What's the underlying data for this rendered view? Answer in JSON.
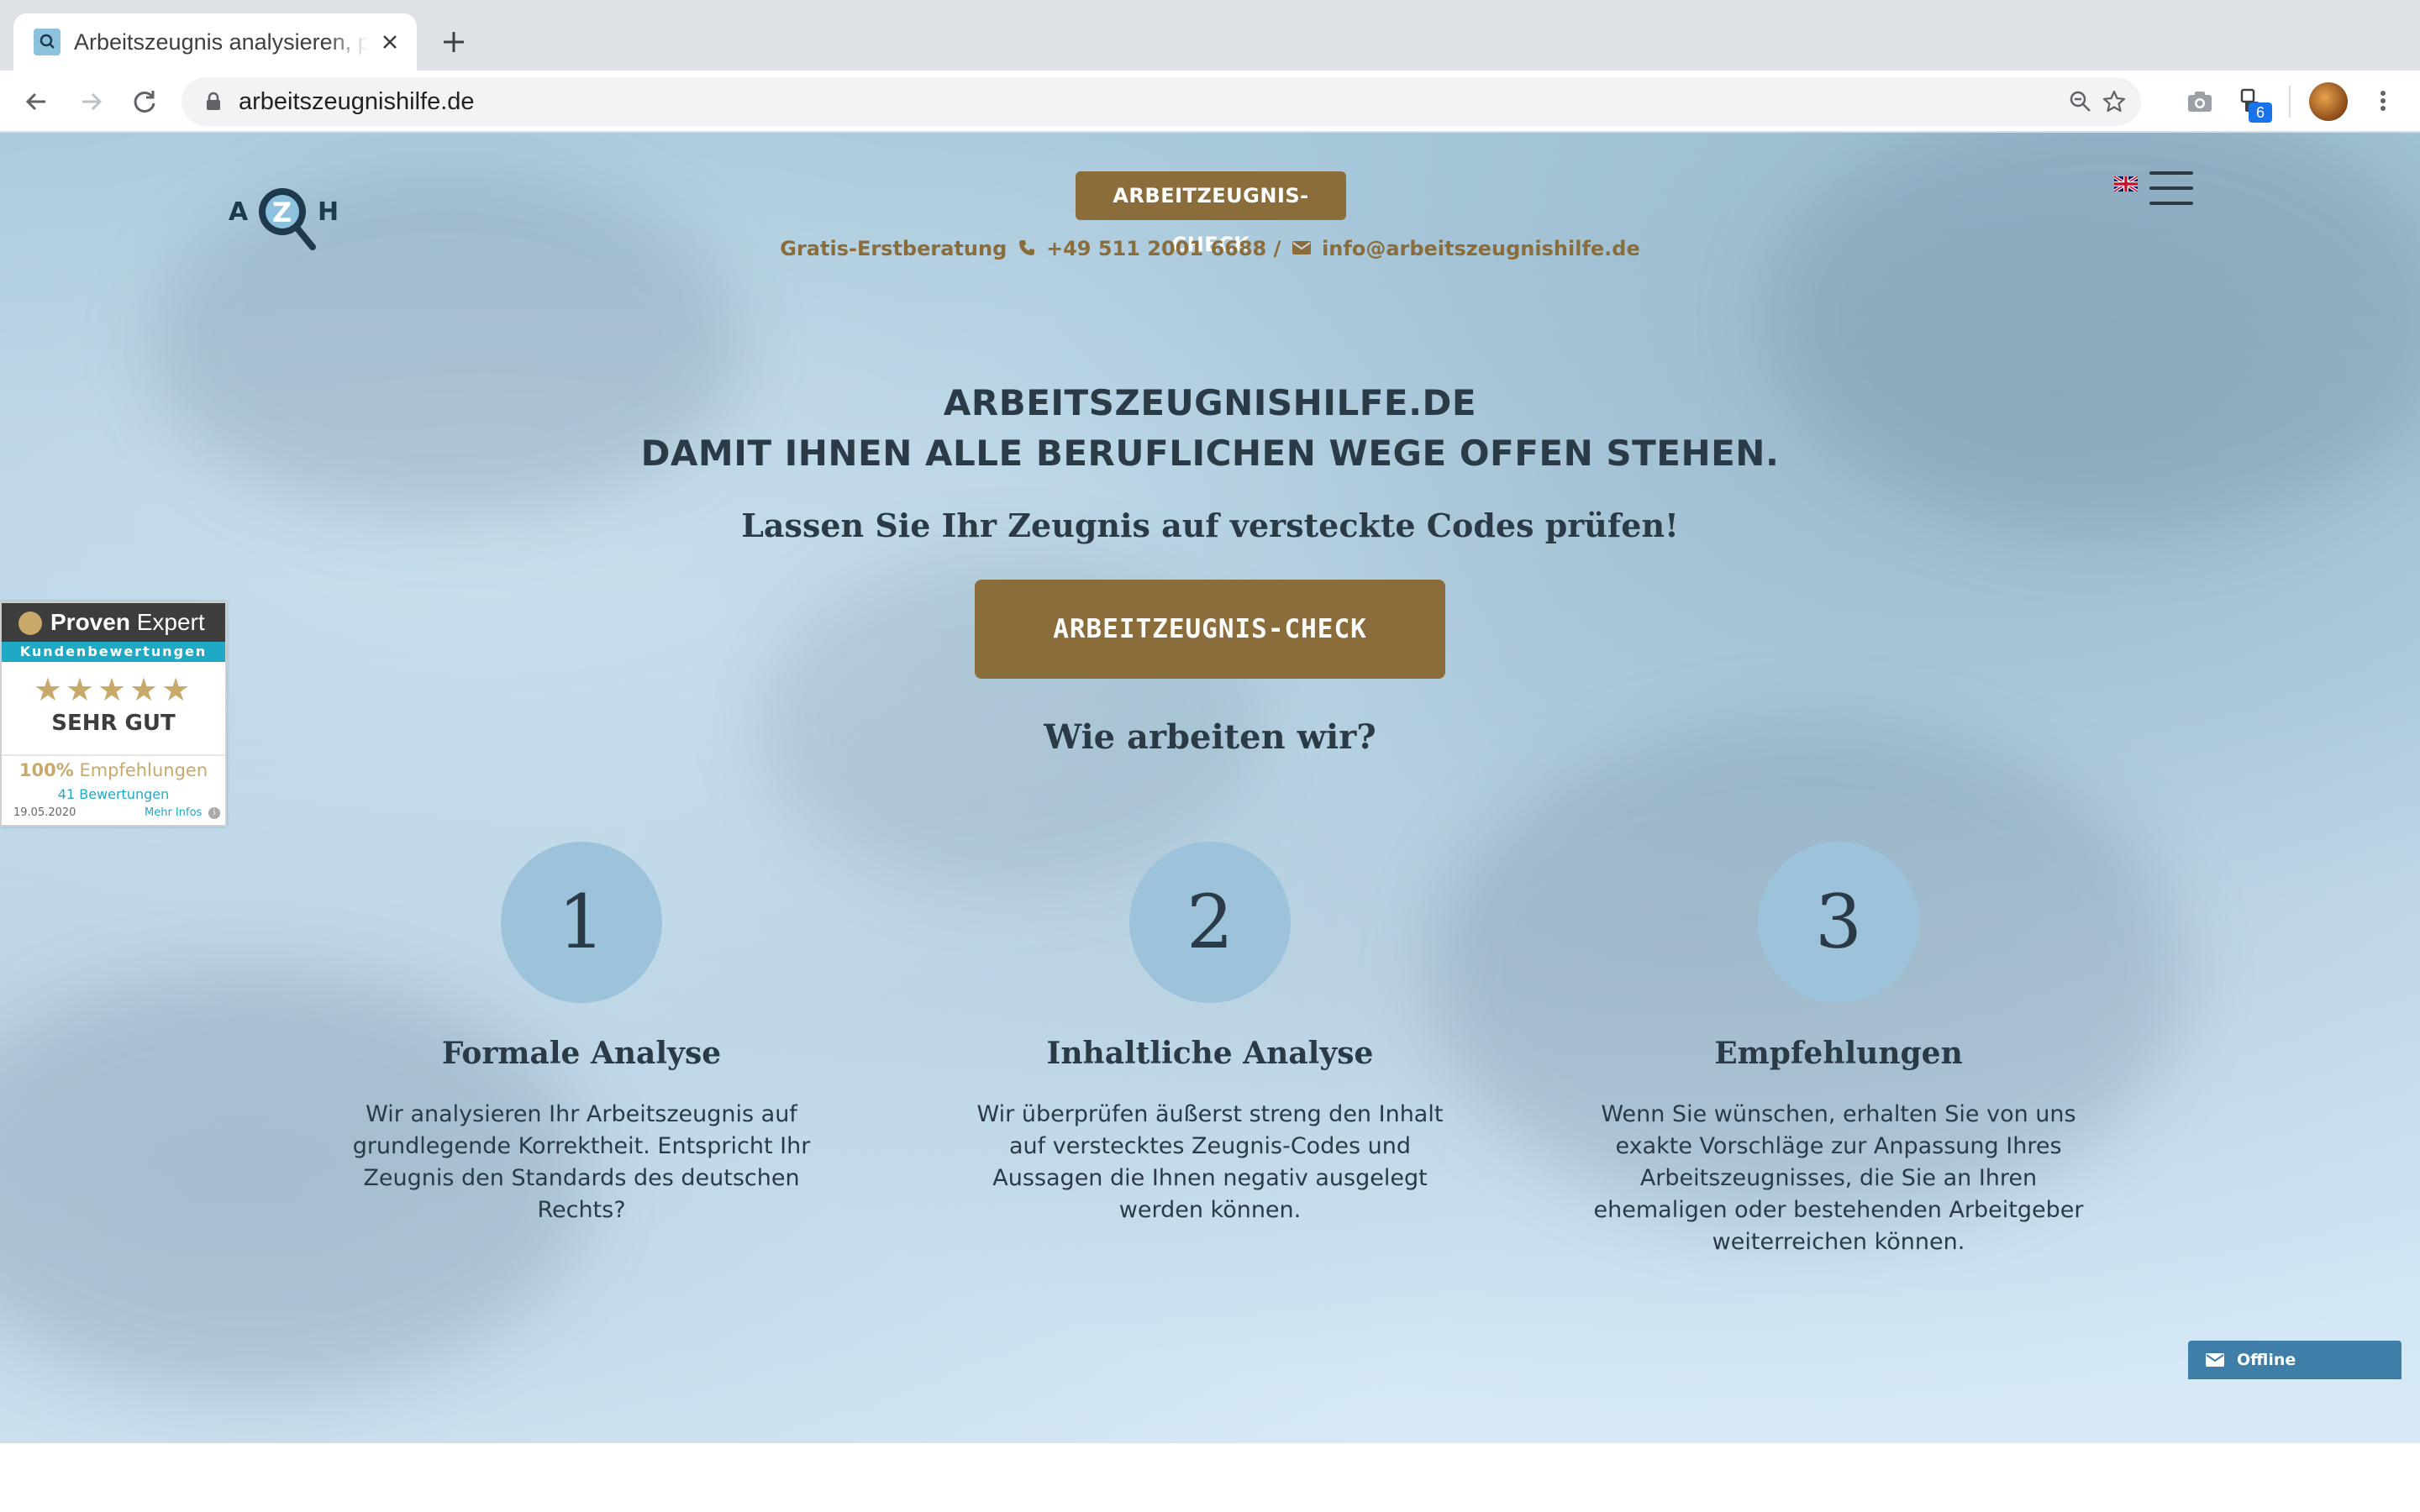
{
  "browser": {
    "tab_title": "Arbeitszeugnis analysieren, prüfen",
    "url": "arbeitszeugnishilfe.de",
    "extension_badge": "6"
  },
  "site": {
    "logo_letters": [
      "A",
      "Z",
      "H"
    ],
    "top_cta": "ARBEITZEUGNIS-CHECK",
    "contact": {
      "label": "Gratis-Erstberatung",
      "phone": "+49 511 2001 6688",
      "separator": "/",
      "email": "info@arbeitszeugnishilfe.de"
    },
    "hero": {
      "title_line1": "ARBEITSZEUGNISHILFE.DE",
      "title_line2": "DAMIT IHNEN ALLE BERUFLICHEN WEGE OFFEN STEHEN.",
      "subtitle": "Lassen Sie Ihr Zeugnis auf versteckte Codes prüfen!",
      "cta": "ARBEITZEUGNIS-CHECK",
      "how_title": "Wie arbeiten wir?"
    },
    "steps": [
      {
        "number": "1",
        "title": "Formale Analyse",
        "text": "Wir analysieren Ihr Arbeitszeugnis auf grundlegende Korrektheit. Entspricht Ihr Zeugnis den Standards des deutschen Rechts?"
      },
      {
        "number": "2",
        "title": "Inhaltliche Analyse",
        "text": "Wir überprüfen äußerst streng den Inhalt auf verstecktes Zeugnis-Codes und Aussagen die Ihnen negativ ausgelegt werden können."
      },
      {
        "number": "3",
        "title": "Empfehlungen",
        "text": "Wenn Sie wünschen, erhalten Sie von uns exakte Vorschläge zur Anpassung Ihres Arbeitszeugnisses, die Sie an Ihren ehemaligen oder bestehenden Arbeitgeber weiterreichen können."
      }
    ],
    "proven_expert": {
      "brand_bold": "Proven",
      "brand_light": "Expert",
      "subtitle": "Kundenbewertungen",
      "stars": 5,
      "grade": "SEHR GUT",
      "recommend_pct": "100%",
      "recommend_label": "Empfehlungen",
      "review_count": "41 Bewertungen",
      "date": "19.05.2020",
      "more_info": "Mehr Infos"
    },
    "chat": {
      "status": "Offline"
    }
  },
  "colors": {
    "brand_brown": "#8a6d3b",
    "text_dark": "#2a3b47",
    "circle_blue": "#9dc3da",
    "proven_teal": "#1fa9c5",
    "proven_gold": "#c8a96a"
  },
  "icons": [
    "back-icon",
    "forward-icon",
    "reload-icon",
    "lock-icon",
    "zoom-icon",
    "star-icon",
    "camera-icon",
    "extension-icon",
    "menu-dots-icon",
    "phone-icon",
    "mail-icon",
    "flag-uk-icon",
    "hamburger-icon"
  ]
}
